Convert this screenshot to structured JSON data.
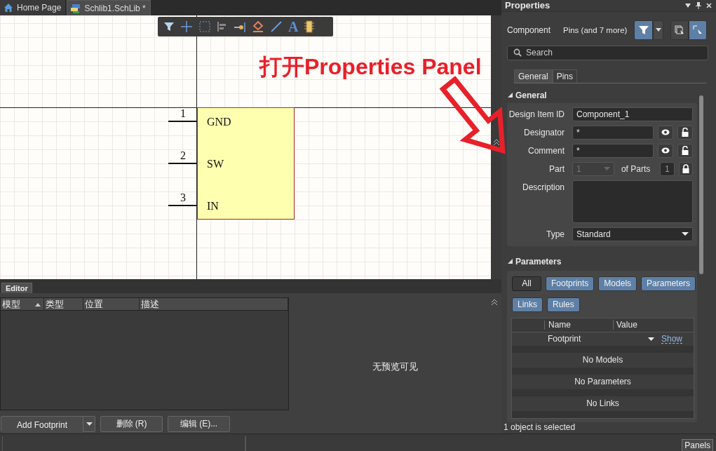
{
  "document_tabs": [
    {
      "label": "Home Page",
      "kind": "home",
      "selected": false
    },
    {
      "label": "Schlib1.SchLib *",
      "kind": "schlib",
      "selected": true
    }
  ],
  "canvas_toolbar": {
    "text_tool": "A"
  },
  "schematic": {
    "pins": [
      {
        "number": "1",
        "name": "GND"
      },
      {
        "number": "2",
        "name": "SW"
      },
      {
        "number": "3",
        "name": "IN"
      }
    ]
  },
  "annotation": {
    "text": "打开Properties Panel"
  },
  "editor": {
    "tab": "Editor",
    "columns": [
      {
        "label": "模型",
        "sorted": true
      },
      {
        "label": "类型",
        "sorted": false
      },
      {
        "label": "位置",
        "sorted": false
      },
      {
        "label": "描述",
        "sorted": false
      }
    ],
    "preview": "无预览可见",
    "buttons": [
      {
        "label": "Add Footprint",
        "kind": "split"
      },
      {
        "label": "删除 (R)",
        "kind": "plain"
      },
      {
        "label": "编辑 (E)...",
        "kind": "plain"
      }
    ]
  },
  "properties": {
    "title": "Properties",
    "object_type": "Component",
    "filter_label": "Pins (and 7 more)",
    "search": {
      "placeholder": "Search"
    },
    "tabs": [
      {
        "label": "General",
        "selected": true
      },
      {
        "label": "Pins",
        "selected": false
      }
    ],
    "general": {
      "title": "General",
      "expanded": true,
      "fields": [
        {
          "label": "Design Item ID",
          "kind": "text",
          "value": "Component_1"
        },
        {
          "label": "Designator",
          "kind": "visible_locked",
          "value": "*",
          "visible": true,
          "locked": false
        },
        {
          "label": "Comment",
          "kind": "visible_locked",
          "value": "*",
          "visible": true,
          "locked": false
        },
        {
          "label": "Part",
          "kind": "part",
          "value": "1",
          "disabled": true,
          "of_label": "of Parts",
          "parts": "1",
          "locked": true
        },
        {
          "label": "Description",
          "kind": "textarea"
        },
        {
          "label": "Type",
          "kind": "select",
          "value": "Standard"
        }
      ]
    },
    "parameters": {
      "title": "Parameters",
      "expanded": true,
      "filters": [
        {
          "label": "All",
          "selected": false
        },
        {
          "label": "Footprints",
          "selected": true
        },
        {
          "label": "Models",
          "selected": true
        },
        {
          "label": "Parameters",
          "selected": true
        },
        {
          "label": "Links",
          "selected": true
        },
        {
          "label": "Rules",
          "selected": true
        }
      ],
      "columns": [
        "Name",
        "Value"
      ],
      "rows": [
        {
          "name": "Footprint",
          "action": "Show"
        }
      ],
      "empty_groups": [
        "No Models",
        "No Parameters",
        "No Links"
      ]
    },
    "status": "1 object is selected"
  },
  "status_bar": {
    "panels_button": "Panels"
  }
}
